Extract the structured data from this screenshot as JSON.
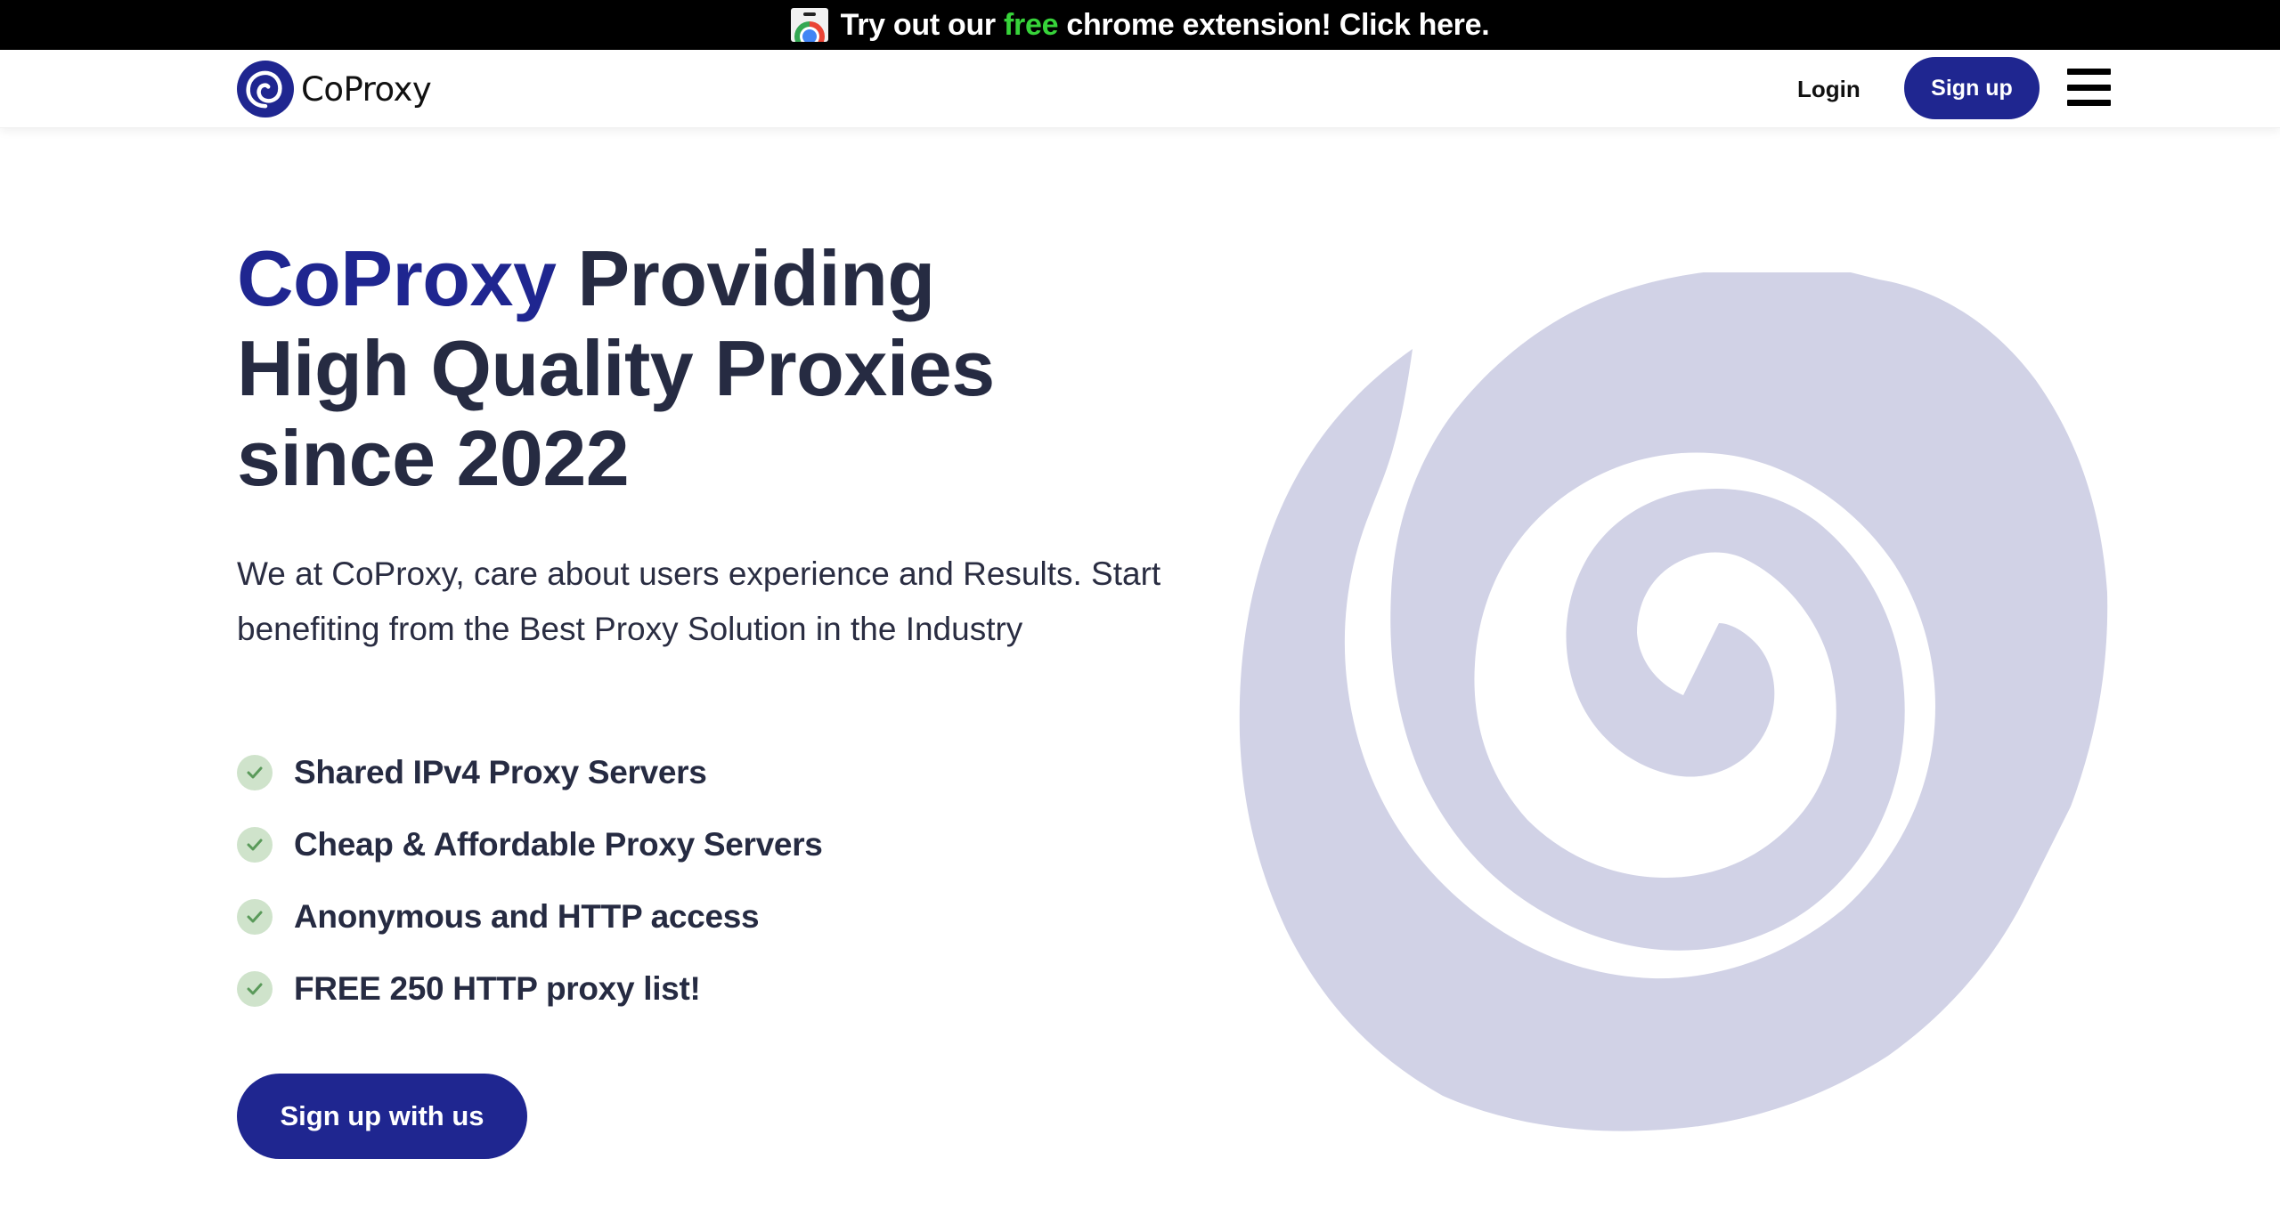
{
  "promo_banner": {
    "icon": "chrome-web-store-icon",
    "text_before": "Try out our ",
    "text_highlight": "free",
    "text_after": " chrome extension! Click here.",
    "highlight_color": "#37d33a"
  },
  "nav": {
    "brand_name": "CoProxy",
    "logo_icon": "spiral-logo-icon",
    "login_label": "Login",
    "signup_label": "Sign up",
    "menu_icon": "hamburger-menu-icon"
  },
  "hero": {
    "title_brand": "CoProxy",
    "title_rest_line1": " Providing",
    "title_line2": "High Quality Proxies",
    "title_line3": "since 2022",
    "description": "We at CoProxy, care about users experience and Results. Start benefiting from the Best Proxy Solution in the Industry",
    "features": [
      {
        "label": "Shared IPv4 Proxy Servers",
        "icon": "check-icon"
      },
      {
        "label": "Cheap & Affordable Proxy Servers",
        "icon": "check-icon"
      },
      {
        "label": "Anonymous and HTTP access",
        "icon": "check-icon"
      },
      {
        "label": "FREE 250 HTTP proxy list!",
        "icon": "check-icon"
      }
    ],
    "cta_label": "Sign up with us",
    "illustration": "spiral-illustration"
  },
  "colors": {
    "brand": "#1f2690",
    "heading": "#262b42",
    "spiral": "#d1d2e6",
    "check_bg": "#cfe3cb",
    "check_mark": "#5a9a5a"
  }
}
